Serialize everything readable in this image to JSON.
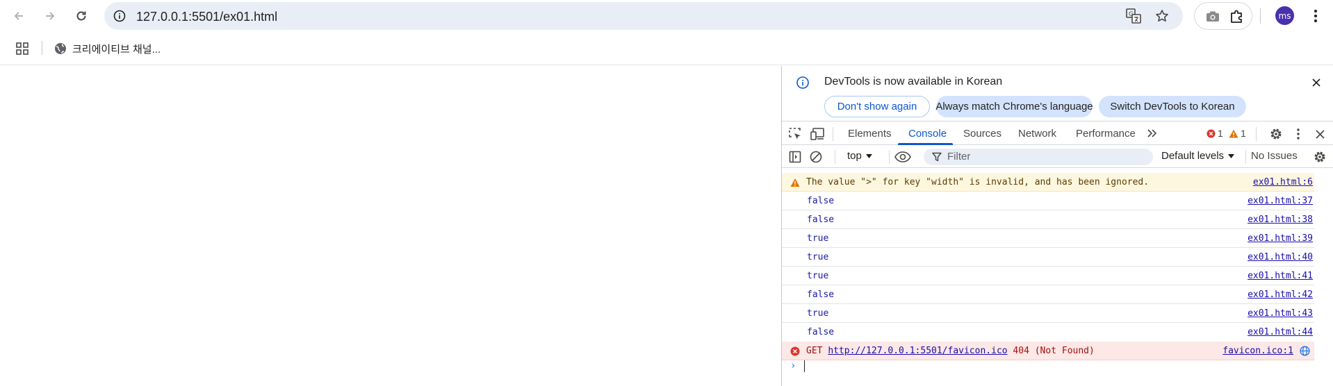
{
  "browser": {
    "url": "127.0.0.1:5501/ex01.html",
    "profile_initials": "ms",
    "icons": [
      "back-icon",
      "forward-icon",
      "reload-icon",
      "site-info-icon",
      "translate-icon",
      "bookmark-star-icon",
      "camera-icon",
      "extensions-icon",
      "menu-icon"
    ]
  },
  "bookmarks": {
    "items": [
      {
        "label": "크리에이티브 채널..."
      }
    ]
  },
  "devtools": {
    "infobar": {
      "message": "DevTools is now available in Korean",
      "buttons": {
        "dont_show": "Don't show again",
        "always_match": "Always match Chrome's language",
        "switch": "Switch DevTools to Korean"
      }
    },
    "tabs": [
      "Elements",
      "Console",
      "Sources",
      "Network",
      "Performance"
    ],
    "active_tab": "Console",
    "counts": {
      "errors": "1",
      "warnings": "1"
    },
    "filterbar": {
      "context": "top",
      "filter_placeholder": "Filter",
      "levels": "Default levels",
      "issues": "No Issues"
    },
    "console": {
      "warning": {
        "text": "The value \">\" for key \"width\" is invalid, and has been ignored.",
        "source": "ex01.html:6"
      },
      "logs": [
        {
          "text": "false",
          "source": "ex01.html:37"
        },
        {
          "text": "false",
          "source": "ex01.html:38"
        },
        {
          "text": "true",
          "source": "ex01.html:39"
        },
        {
          "text": "true",
          "source": "ex01.html:40"
        },
        {
          "text": "true",
          "source": "ex01.html:41"
        },
        {
          "text": "false",
          "source": "ex01.html:42"
        },
        {
          "text": "true",
          "source": "ex01.html:43"
        },
        {
          "text": "false",
          "source": "ex01.html:44"
        }
      ],
      "error": {
        "method": "GET",
        "url": "http://127.0.0.1:5501/favicon.ico",
        "status": "404 (Not Found)",
        "source": "favicon.ico:1"
      },
      "prompt": "›"
    }
  },
  "colors": {
    "accent": "#0b57d0",
    "omnibox_bg": "#e9eef6",
    "warning_bg": "#fef7e0",
    "error_bg": "#fce8e6",
    "log_value": "#1a1aa6",
    "avatar": "#4a2fb0"
  }
}
